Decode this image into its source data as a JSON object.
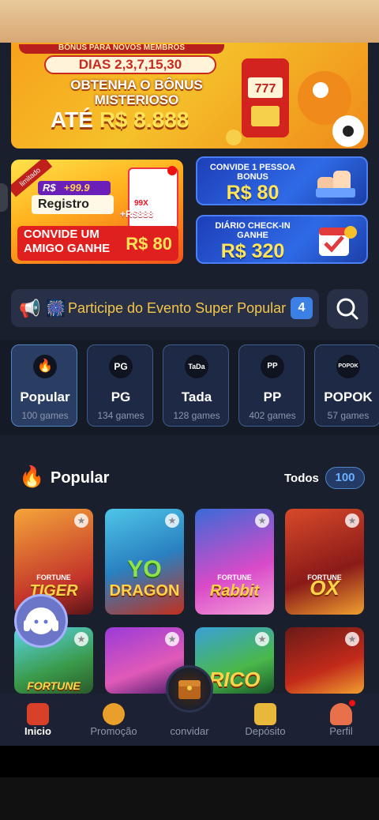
{
  "banner_main": {
    "top_strip": "BÔNUS PARA NOVOS MEMBROS",
    "days": "DIAS 2,3,7,15,30",
    "line1": "OBTENHA O BÔNUS",
    "line2": "MISTERIOSO",
    "ate_prefix": "ATÉ",
    "ate_amount": "R$ 8.888"
  },
  "card_register": {
    "ribbon": "limitado",
    "plus_currency": "R$",
    "plus_amount": "+99.9",
    "register_label": "Registro",
    "phone_tag": "99X",
    "bonus_tag": "+R$888",
    "invite_line1": "CONVIDE UM",
    "invite_line2": "AMIGO GANHE",
    "invite_amount": "R$ 80"
  },
  "card_invite": {
    "title_l1": "CONVIDE 1 PESSOA",
    "title_l2": "BONUS",
    "amount": "R$ 80"
  },
  "card_checkin": {
    "title_l1": "DIÁRIO CHECK-IN",
    "title_l2": "GANHE",
    "amount": "R$ 320"
  },
  "marquee": {
    "text": "Participe do Evento Super Popular",
    "badge": "4"
  },
  "categories": [
    {
      "name": "Popular",
      "count": "100 games",
      "logo": "🔥"
    },
    {
      "name": "PG",
      "count": "134 games",
      "logo": "PG"
    },
    {
      "name": "Tada",
      "count": "128 games",
      "logo": "TaDa"
    },
    {
      "name": "PP",
      "count": "402 games",
      "logo": "PP"
    },
    {
      "name": "POPOK",
      "count": "57 games",
      "logo": "POPOK"
    }
  ],
  "section": {
    "title": "Popular",
    "todos": "Todos",
    "count": "100"
  },
  "games": [
    {
      "name": "TIGER",
      "sub": "FORTUNE"
    },
    {
      "name": "DRAGON",
      "sub": "YO"
    },
    {
      "name": "Rabbit",
      "sub": "FORTUNE"
    },
    {
      "name": "OX",
      "sub": "FORTUNE"
    },
    {
      "name": "FORTUNE",
      "sub": ""
    },
    {
      "name": "",
      "sub": ""
    },
    {
      "name": "RICO",
      "sub": ""
    },
    {
      "name": "",
      "sub": ""
    }
  ],
  "nav": {
    "inicio": "Inicio",
    "promocao": "Promoção",
    "convidar": "convidar",
    "deposito": "Depósito",
    "perfil": "Perfil"
  },
  "colors": {
    "background": "#1a1f2e",
    "accent_gold": "#ffe45a",
    "accent_blue": "#3c80e6"
  }
}
